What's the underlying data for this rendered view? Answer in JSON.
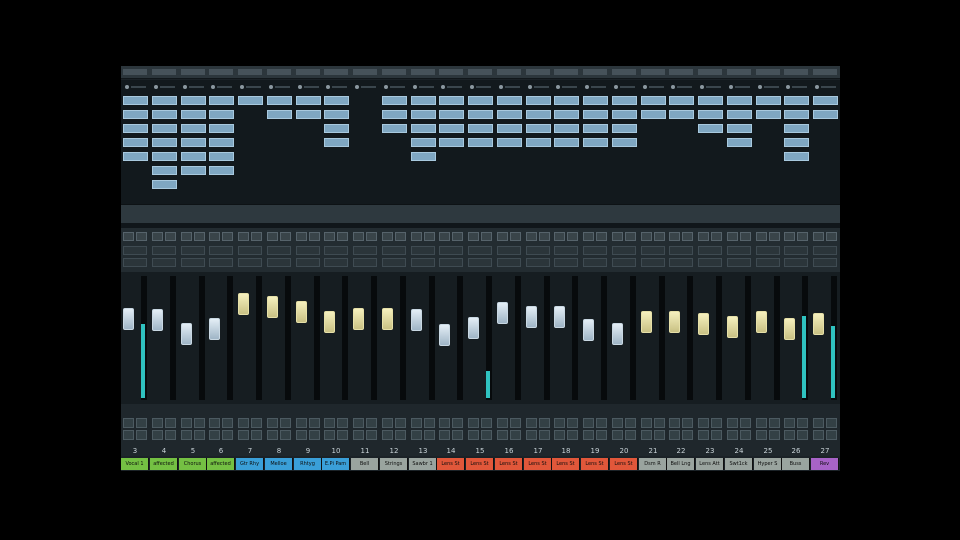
{
  "channels": [
    {
      "number": "3",
      "name": "Vocal 1",
      "color": "#74c043",
      "fader": "blue",
      "fader_level": 0.74,
      "meter_level": 0.6,
      "slots": 5
    },
    {
      "number": "4",
      "name": "affected",
      "color": "#74c043",
      "fader": "blue",
      "fader_level": 0.73,
      "meter_level": 0,
      "slots": 7
    },
    {
      "number": "5",
      "name": "Chorus",
      "color": "#74c043",
      "fader": "blue",
      "fader_level": 0.62,
      "meter_level": 0,
      "slots": 6
    },
    {
      "number": "6",
      "name": "affected",
      "color": "#74c043",
      "fader": "blue",
      "fader_level": 0.66,
      "meter_level": 0,
      "slots": 6
    },
    {
      "number": "7",
      "name": "Gtr Rhy",
      "color": "#3a9fd8",
      "fader": "yellow",
      "fader_level": 0.86,
      "meter_level": 0,
      "slots": 1
    },
    {
      "number": "8",
      "name": "Melloe",
      "color": "#3a9fd8",
      "fader": "yellow",
      "fader_level": 0.84,
      "meter_level": 0,
      "slots": 2
    },
    {
      "number": "9",
      "name": "Rhtyg",
      "color": "#3a9fd8",
      "fader": "yellow",
      "fader_level": 0.8,
      "meter_level": 0,
      "slots": 2
    },
    {
      "number": "10",
      "name": "E.Pi Pam",
      "color": "#3a9fd8",
      "fader": "yellow",
      "fader_level": 0.72,
      "meter_level": 0,
      "slots": 4
    },
    {
      "number": "11",
      "name": "Bell",
      "color": "#9aa49f",
      "fader": "yellow",
      "fader_level": 0.74,
      "meter_level": 0,
      "slots": 0
    },
    {
      "number": "12",
      "name": "Strings",
      "color": "#9aa49f",
      "fader": "yellow",
      "fader_level": 0.74,
      "meter_level": 0,
      "slots": 3
    },
    {
      "number": "13",
      "name": "Sawbr 1",
      "color": "#9aa49f",
      "fader": "blue",
      "fader_level": 0.73,
      "meter_level": 0,
      "slots": 5
    },
    {
      "number": "14",
      "name": "Lens St",
      "color": "#e1573a",
      "fader": "blue",
      "fader_level": 0.61,
      "meter_level": 0,
      "slots": 4
    },
    {
      "number": "15",
      "name": "Lens St",
      "color": "#e1573a",
      "fader": "blue",
      "fader_level": 0.67,
      "meter_level": 0.22,
      "slots": 4
    },
    {
      "number": "16",
      "name": "Lens St",
      "color": "#e1573a",
      "fader": "blue",
      "fader_level": 0.79,
      "meter_level": 0,
      "slots": 4
    },
    {
      "number": "17",
      "name": "Lens St",
      "color": "#e1573a",
      "fader": "blue",
      "fader_level": 0.76,
      "meter_level": 0,
      "slots": 4
    },
    {
      "number": "18",
      "name": "Lens St",
      "color": "#e1573a",
      "fader": "blue",
      "fader_level": 0.76,
      "meter_level": 0,
      "slots": 4
    },
    {
      "number": "19",
      "name": "Lens St",
      "color": "#e1573a",
      "fader": "blue",
      "fader_level": 0.65,
      "meter_level": 0,
      "slots": 4
    },
    {
      "number": "20",
      "name": "Lens St",
      "color": "#e1573a",
      "fader": "blue",
      "fader_level": 0.62,
      "meter_level": 0,
      "slots": 4
    },
    {
      "number": "21",
      "name": "Dsm R",
      "color": "#9aa49f",
      "fader": "yellow",
      "fader_level": 0.72,
      "meter_level": 0,
      "slots": 2
    },
    {
      "number": "22",
      "name": "Bell Lng",
      "color": "#9aa49f",
      "fader": "yellow",
      "fader_level": 0.72,
      "meter_level": 0,
      "slots": 2
    },
    {
      "number": "23",
      "name": "Lens Att",
      "color": "#9aa49f",
      "fader": "yellow",
      "fader_level": 0.7,
      "meter_level": 0,
      "slots": 3
    },
    {
      "number": "24",
      "name": "Swt1ck",
      "color": "#9aa49f",
      "fader": "yellow",
      "fader_level": 0.68,
      "meter_level": 0,
      "slots": 4
    },
    {
      "number": "25",
      "name": "Hyper S",
      "color": "#9aa49f",
      "fader": "yellow",
      "fader_level": 0.72,
      "meter_level": 0,
      "slots": 2
    },
    {
      "number": "26",
      "name": "Buss",
      "color": "#9aa49f",
      "fader": "yellow",
      "fader_level": 0.66,
      "meter_level": 0.66,
      "slots": 5
    },
    {
      "number": "27",
      "name": "Rev",
      "color": "#a763c7",
      "fader": "yellow",
      "fader_level": 0.7,
      "meter_level": 0.58,
      "slots": 2
    }
  ]
}
